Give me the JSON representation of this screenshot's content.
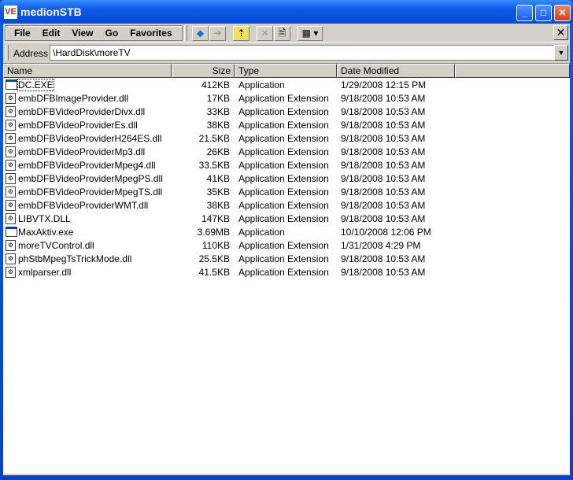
{
  "window": {
    "title": "medionSTB",
    "app_icon_text": "VE",
    "minimize": "_",
    "maximize": "□",
    "close": "✕"
  },
  "menu": [
    "File",
    "Edit",
    "View",
    "Go",
    "Favorites"
  ],
  "toolbar": {
    "back": "◆",
    "forward": "➔",
    "up": "⇡",
    "delete": "✕",
    "properties": "🗎",
    "views": "▦ ▾",
    "close_toolbar": "✕"
  },
  "address": {
    "label": "Address",
    "value": "\\HardDisk\\moreTV",
    "dropdown": "▼"
  },
  "columns": [
    "Name",
    "Size",
    "Type",
    "Date Modified"
  ],
  "files": [
    {
      "name": "DC.EXE",
      "size": "412KB",
      "type": "Application",
      "date": "1/29/2008 12:15 PM",
      "icon": "exe"
    },
    {
      "name": "embDFBImageProvider.dll",
      "size": "17KB",
      "type": "Application Extension",
      "date": "9/18/2008 10:53 AM",
      "icon": "dll"
    },
    {
      "name": "embDFBVideoProviderDivx.dll",
      "size": "33KB",
      "type": "Application Extension",
      "date": "9/18/2008 10:53 AM",
      "icon": "dll"
    },
    {
      "name": "embDFBVideoProviderEs.dll",
      "size": "38KB",
      "type": "Application Extension",
      "date": "9/18/2008 10:53 AM",
      "icon": "dll"
    },
    {
      "name": "embDFBVideoProviderH264ES.dll",
      "size": "21.5KB",
      "type": "Application Extension",
      "date": "9/18/2008 10:53 AM",
      "icon": "dll"
    },
    {
      "name": "embDFBVideoProviderMp3.dll",
      "size": "26KB",
      "type": "Application Extension",
      "date": "9/18/2008 10:53 AM",
      "icon": "dll"
    },
    {
      "name": "embDFBVideoProviderMpeg4.dll",
      "size": "33.5KB",
      "type": "Application Extension",
      "date": "9/18/2008 10:53 AM",
      "icon": "dll"
    },
    {
      "name": "embDFBVideoProviderMpegPS.dll",
      "size": "41KB",
      "type": "Application Extension",
      "date": "9/18/2008 10:53 AM",
      "icon": "dll"
    },
    {
      "name": "embDFBVideoProviderMpegTS.dll",
      "size": "35KB",
      "type": "Application Extension",
      "date": "9/18/2008 10:53 AM",
      "icon": "dll"
    },
    {
      "name": "embDFBVideoProviderWMT.dll",
      "size": "38KB",
      "type": "Application Extension",
      "date": "9/18/2008 10:53 AM",
      "icon": "dll"
    },
    {
      "name": "LIBVTX.DLL",
      "size": "147KB",
      "type": "Application Extension",
      "date": "9/18/2008 10:53 AM",
      "icon": "dll"
    },
    {
      "name": "MaxAktiv.exe",
      "size": "3.69MB",
      "type": "Application",
      "date": "10/10/2008 12:06 PM",
      "icon": "exe"
    },
    {
      "name": "moreTVControl.dll",
      "size": "110KB",
      "type": "Application Extension",
      "date": "1/31/2008 4:29 PM",
      "icon": "dll"
    },
    {
      "name": "phStbMpegTsTrickMode.dll",
      "size": "25.5KB",
      "type": "Application Extension",
      "date": "9/18/2008 10:53 AM",
      "icon": "dll"
    },
    {
      "name": "xmlparser.dll",
      "size": "41.5KB",
      "type": "Application Extension",
      "date": "9/18/2008 10:53 AM",
      "icon": "dll"
    }
  ]
}
